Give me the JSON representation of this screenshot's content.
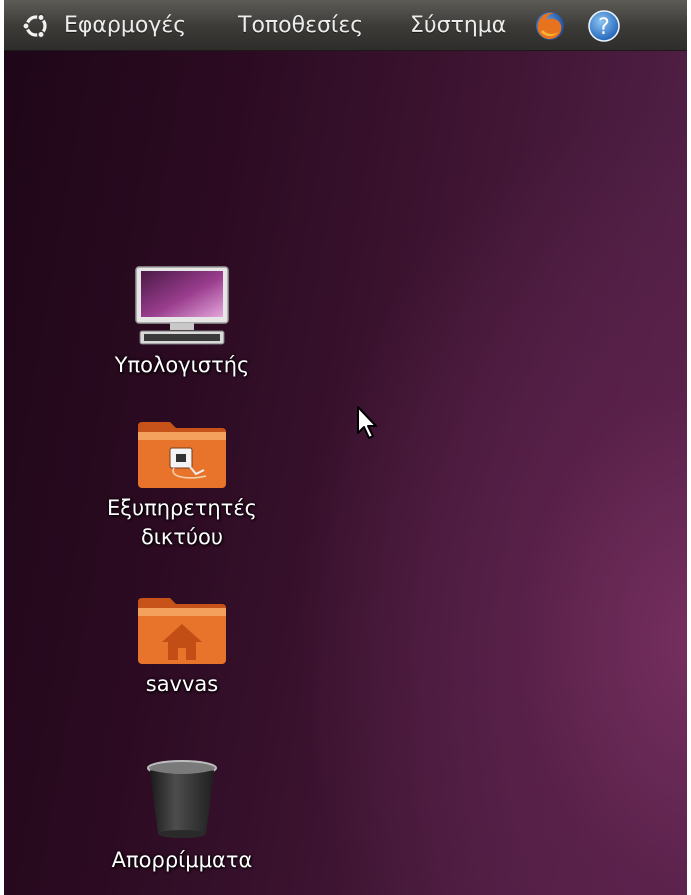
{
  "top_panel": {
    "menus": {
      "applications": "Εφαρμογές",
      "places": "Τοποθεσίες",
      "system": "Σύστημα"
    },
    "logo_icon": "ubuntu-logo-icon",
    "launchers": [
      "firefox-icon",
      "help-icon"
    ]
  },
  "desktop": {
    "icons": {
      "computer": {
        "label": "Υπολογιστής",
        "icon": "computer-icon"
      },
      "network": {
        "line1": "Εξυπηρετητές",
        "line2": "δικτύου",
        "icon": "network-folder-icon"
      },
      "home": {
        "label": "savvas",
        "icon": "home-folder-icon"
      },
      "trash": {
        "label": "Απορρίμματα",
        "icon": "trash-icon"
      }
    }
  },
  "colors": {
    "panel": "#3b3a37",
    "desktop_dark": "#1e0617",
    "desktop_light": "#5b2550",
    "folder_orange": "#e8742c"
  }
}
